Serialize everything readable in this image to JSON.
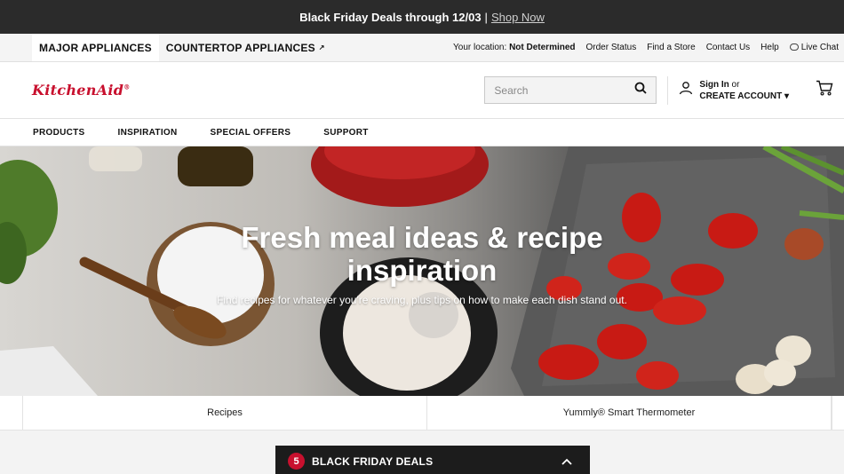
{
  "promo": {
    "text": "Black Friday Deals through 12/03",
    "separator": "|",
    "link": "Shop Now"
  },
  "utility": {
    "tabs": [
      {
        "label": "MAJOR APPLIANCES"
      },
      {
        "label": "COUNTERTOP APPLIANCES",
        "ext": "↗"
      }
    ],
    "location_label": "Your location:",
    "location_value": "Not Determined",
    "links": [
      "Order Status",
      "Find a Store",
      "Contact Us",
      "Help",
      "Live Chat"
    ]
  },
  "header": {
    "logo": "KitchenAid",
    "logo_mark": "®",
    "search_placeholder": "Search",
    "sign_in": "Sign In",
    "or": "or",
    "create_account": "CREATE ACCOUNT ▾"
  },
  "nav": [
    "PRODUCTS",
    "INSPIRATION",
    "SPECIAL OFFERS",
    "SUPPORT"
  ],
  "hero": {
    "title": "Fresh meal ideas & recipe inspiration",
    "subtitle": "Find recipes for whatever you're craving, plus tips on how to make each dish stand out."
  },
  "sublinks": [
    "Recipes",
    "Yummly® Smart Thermometer"
  ],
  "deals": {
    "count": "5",
    "label": "BLACK FRIDAY DEALS"
  },
  "colors": {
    "brand": "#c8102e",
    "promo_bg": "#2b2b2b",
    "deals_bg": "#1c1c1c"
  },
  "icons": [
    "search-icon",
    "user-icon",
    "cart-icon",
    "chat-icon",
    "chevron-up-icon",
    "external-link-icon"
  ]
}
